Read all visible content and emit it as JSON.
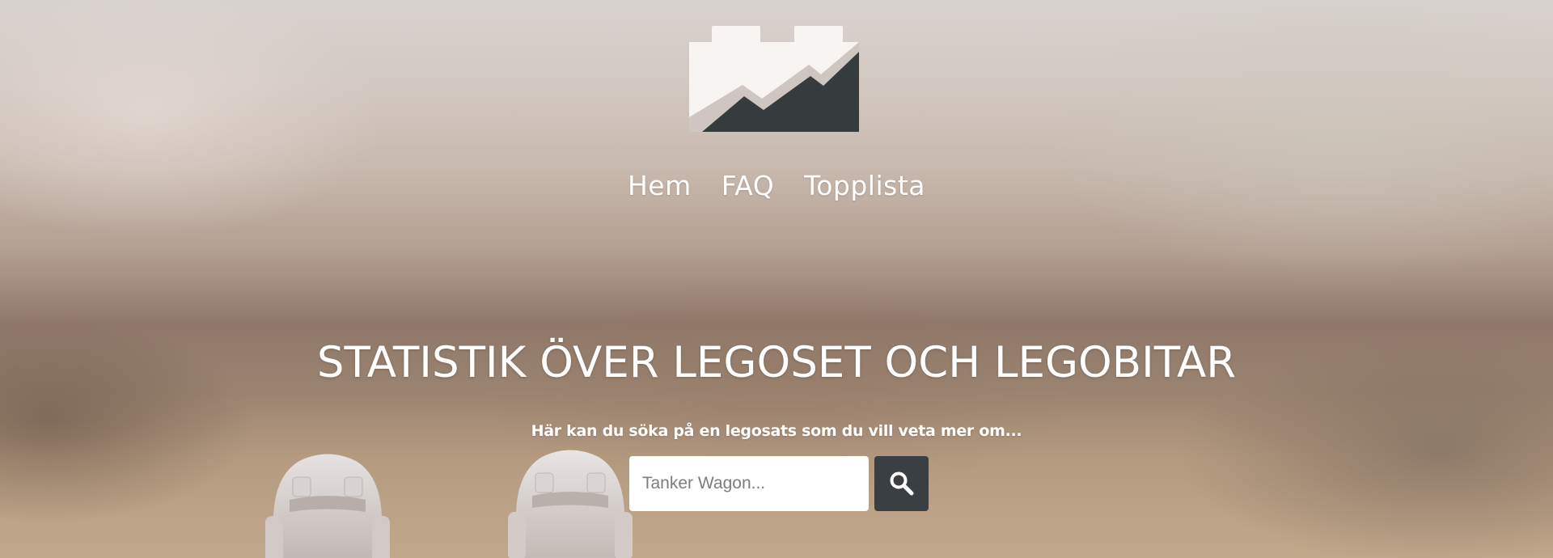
{
  "nav": {
    "items": [
      {
        "label": "Hem"
      },
      {
        "label": "FAQ"
      },
      {
        "label": "Topplista"
      }
    ]
  },
  "hero": {
    "headline": "STATISTIK ÖVER LEGOSET OCH LEGOBITAR",
    "subtext": "Här kan du söka på en legosats som du vill veta mer om..."
  },
  "search": {
    "placeholder": "Tanker Wagon...",
    "value": "",
    "button_icon": "search-icon"
  },
  "colors": {
    "logo_light": "#f7f4f2",
    "logo_dark": "#363b3e",
    "search_button": "#3a3f43",
    "text": "#ffffff"
  }
}
